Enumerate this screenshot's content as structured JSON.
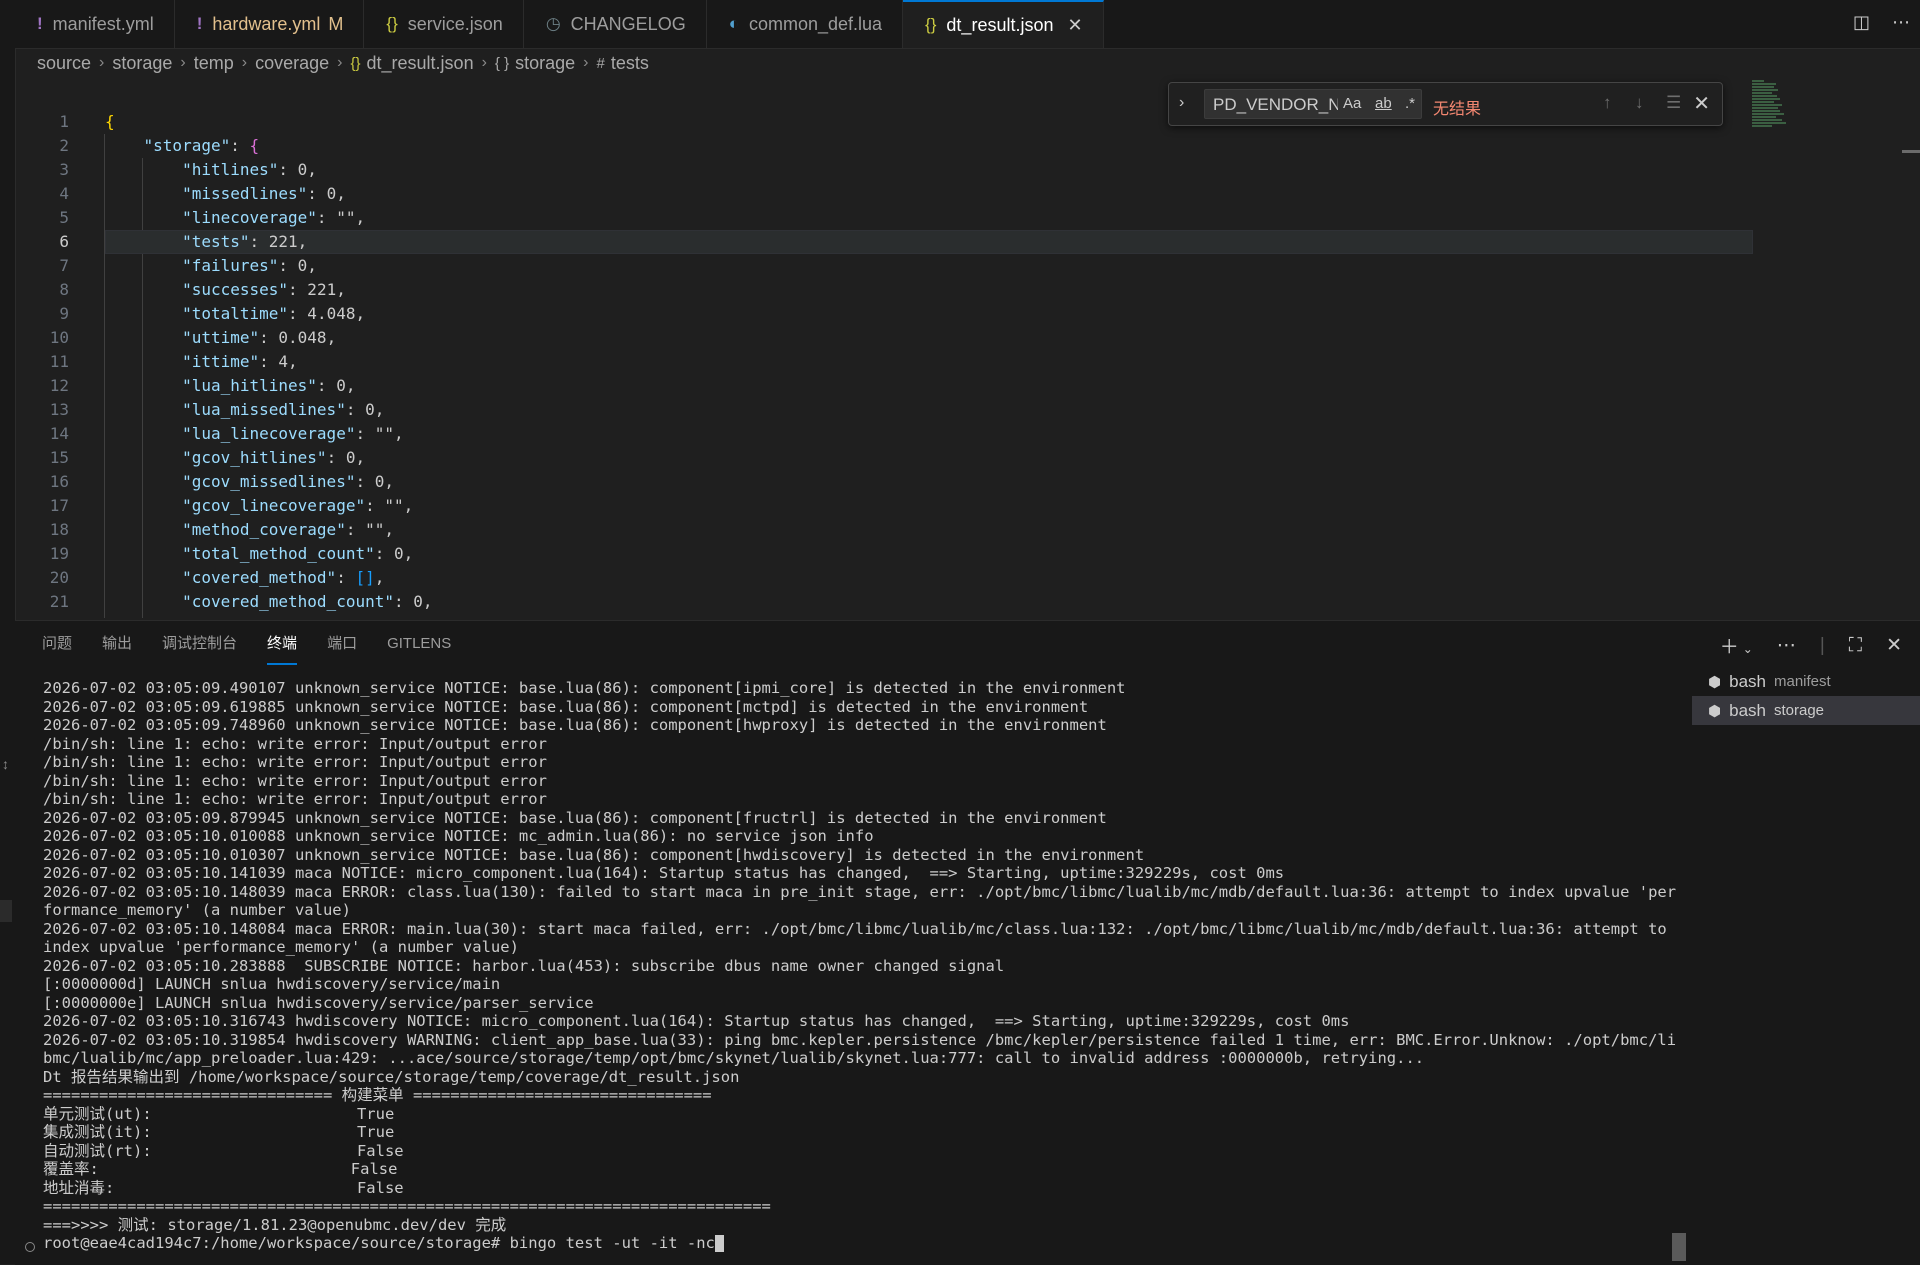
{
  "tabs": [
    {
      "icon": "yaml-icon",
      "glyph": "!",
      "label": "manifest.yml",
      "modified": "",
      "active": false
    },
    {
      "icon": "yaml-icon",
      "glyph": "!",
      "label": "hardware.yml",
      "modified": "M",
      "active": false
    },
    {
      "icon": "json-icon",
      "glyph": "{}",
      "label": "service.json",
      "modified": "",
      "active": false
    },
    {
      "icon": "clock-icon",
      "glyph": "◷",
      "label": "CHANGELOG",
      "modified": "",
      "active": false
    },
    {
      "icon": "lua-icon",
      "glyph": "◐",
      "label": "common_def.lua",
      "modified": "",
      "active": false
    },
    {
      "icon": "json-icon",
      "glyph": "{}",
      "label": "dt_result.json",
      "modified": "",
      "active": true
    }
  ],
  "breadcrumbs": [
    "source",
    "storage",
    "temp",
    "coverage",
    "dt_result.json",
    "storage",
    "tests"
  ],
  "find": {
    "value": "PD_VENDOR_N",
    "match_case": "Aa",
    "whole_word": "ab",
    "regex": ".*",
    "result": "无结果"
  },
  "editor": {
    "current_line": 6,
    "lines": [
      {
        "n": "1",
        "t": "{"
      },
      {
        "n": "2",
        "t": "    \"storage\": {"
      },
      {
        "n": "3",
        "t": "        \"hitlines\": 0,"
      },
      {
        "n": "4",
        "t": "        \"missedlines\": 0,"
      },
      {
        "n": "5",
        "t": "        \"linecoverage\": \"\","
      },
      {
        "n": "6",
        "t": "        \"tests\": 221,"
      },
      {
        "n": "7",
        "t": "        \"failures\": 0,"
      },
      {
        "n": "8",
        "t": "        \"successes\": 221,"
      },
      {
        "n": "9",
        "t": "        \"totaltime\": 4.048,"
      },
      {
        "n": "10",
        "t": "        \"uttime\": 0.048,"
      },
      {
        "n": "11",
        "t": "        \"ittime\": 4,"
      },
      {
        "n": "12",
        "t": "        \"lua_hitlines\": 0,"
      },
      {
        "n": "13",
        "t": "        \"lua_missedlines\": 0,"
      },
      {
        "n": "14",
        "t": "        \"lua_linecoverage\": \"\","
      },
      {
        "n": "15",
        "t": "        \"gcov_hitlines\": 0,"
      },
      {
        "n": "16",
        "t": "        \"gcov_missedlines\": 0,"
      },
      {
        "n": "17",
        "t": "        \"gcov_linecoverage\": \"\","
      },
      {
        "n": "18",
        "t": "        \"method_coverage\": \"\","
      },
      {
        "n": "19",
        "t": "        \"total_method_count\": 0,"
      },
      {
        "n": "20",
        "t": "        \"covered_method\": [],"
      },
      {
        "n": "21",
        "t": "        \"covered_method_count\": 0,"
      }
    ]
  },
  "panel": {
    "tabs": [
      "问题",
      "输出",
      "调试控制台",
      "终端",
      "端口",
      "GITLENS"
    ],
    "active_tab": "终端",
    "terminals": [
      {
        "shell": "bash",
        "name": "manifest",
        "active": false
      },
      {
        "shell": "bash",
        "name": "storage",
        "active": true
      }
    ],
    "terminal_lines": [
      "2026-07-02 03:05:09.490107 unknown_service NOTICE: base.lua(86): component[ipmi_core] is detected in the environment",
      "2026-07-02 03:05:09.619885 unknown_service NOTICE: base.lua(86): component[mctpd] is detected in the environment",
      "2026-07-02 03:05:09.748960 unknown_service NOTICE: base.lua(86): component[hwproxy] is detected in the environment",
      "/bin/sh: line 1: echo: write error: Input/output error",
      "/bin/sh: line 1: echo: write error: Input/output error",
      "/bin/sh: line 1: echo: write error: Input/output error",
      "/bin/sh: line 1: echo: write error: Input/output error",
      "2026-07-02 03:05:09.879945 unknown_service NOTICE: base.lua(86): component[fructrl] is detected in the environment",
      "2026-07-02 03:05:10.010088 unknown_service NOTICE: mc_admin.lua(86): no service json info",
      "2026-07-02 03:05:10.010307 unknown_service NOTICE: base.lua(86): component[hwdiscovery] is detected in the environment",
      "2026-07-02 03:05:10.141039 maca NOTICE: micro_component.lua(164): Startup status has changed,  ==> Starting, uptime:329229s, cost 0ms",
      "2026-07-02 03:05:10.148039 maca ERROR: class.lua(130): failed to start maca in pre_init stage, err: ./opt/bmc/libmc/lualib/mc/mdb/default.lua:36: attempt to index upvalue 'per",
      "formance_memory' (a number value)",
      "2026-07-02 03:05:10.148084 maca ERROR: main.lua(30): start maca failed, err: ./opt/bmc/libmc/lualib/mc/class.lua:132: ./opt/bmc/libmc/lualib/mc/mdb/default.lua:36: attempt to",
      "index upvalue 'performance_memory' (a number value)",
      "2026-07-02 03:05:10.283888  SUBSCRIBE NOTICE: harbor.lua(453): subscribe dbus name owner changed signal",
      "[:0000000d] LAUNCH snlua hwdiscovery/service/main",
      "[:0000000e] LAUNCH snlua hwdiscovery/service/parser_service",
      "2026-07-02 03:05:10.316743 hwdiscovery NOTICE: micro_component.lua(164): Startup status has changed,  ==> Starting, uptime:329229s, cost 0ms",
      "2026-07-02 03:05:10.319854 hwdiscovery WARNING: client_app_base.lua(33): ping bmc.kepler.persistence /bmc/kepler/persistence failed 1 time, err: BMC.Error.Unknow: ./opt/bmc/li",
      "bmc/lualib/mc/app_preloader.lua:429: ...ace/source/storage/temp/opt/bmc/skynet/lualib/skynet.lua:777: call to invalid address :0000000b, retrying...",
      "Dt 报告结果输出到 /home/workspace/source/storage/temp/coverage/dt_result.json",
      "=============================== 构建菜单 ================================",
      "单元测试(ut):                      True",
      "集成测试(it):                      True",
      "自动测试(rt):                      False",
      "覆盖率:                           False",
      "地址消毒:                          False",
      "==============================================================================",
      "===>>>> 测试: storage/1.81.23@openubmc.dev/dev 完成"
    ],
    "prompt": "root@eae4cad194c7:/home/workspace/source/storage# bingo test -ut -it -nc"
  }
}
